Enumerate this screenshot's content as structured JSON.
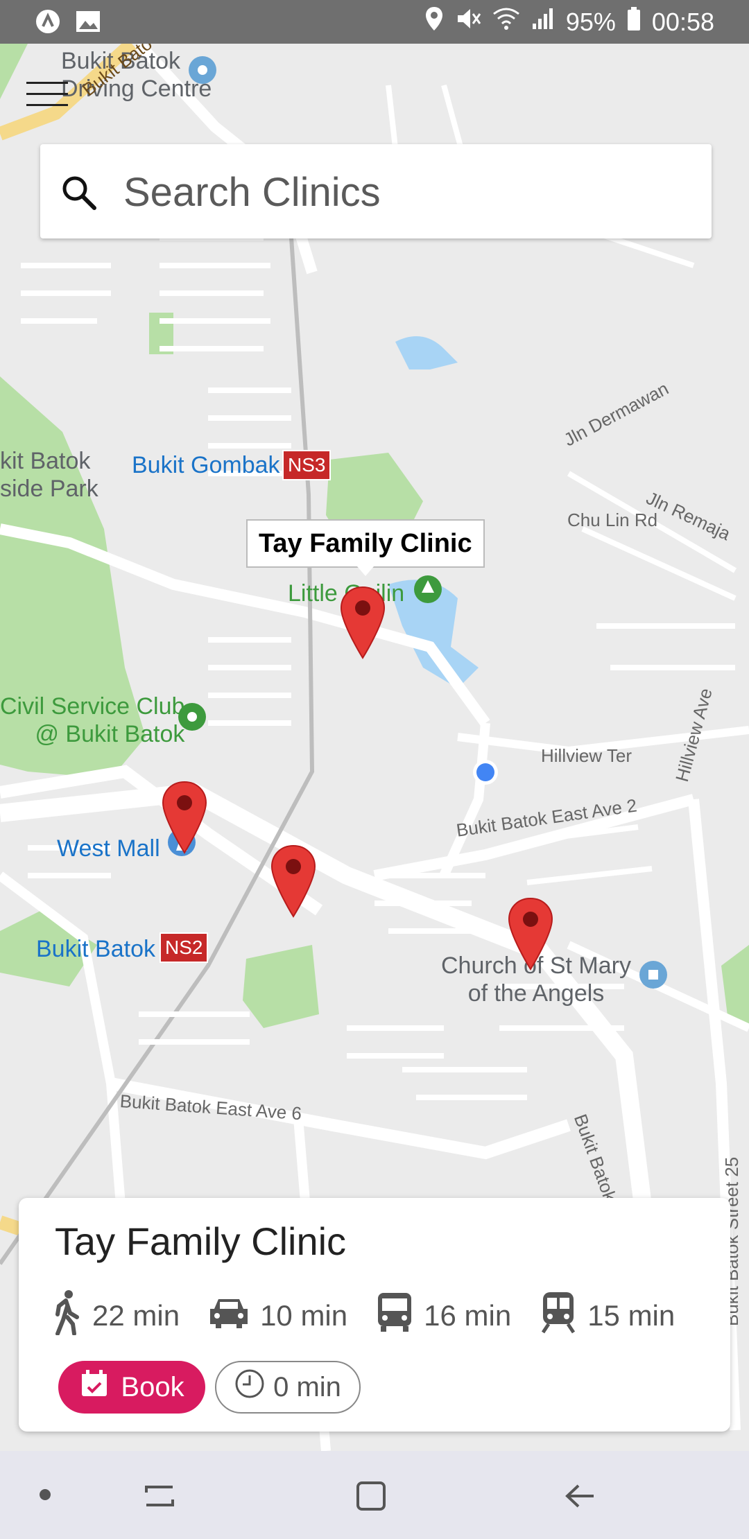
{
  "status_bar": {
    "battery": "95%",
    "time": "00:58"
  },
  "search": {
    "placeholder": "Search Clinics"
  },
  "tooltip": {
    "label": "Tay Family Clinic"
  },
  "map": {
    "labels": {
      "driving_centre": "Bukit Batok\nDriving Centre",
      "road_top": "Bukit Bato",
      "hillside_park": "kit Batok\nside Park",
      "bukit_gombak": "Bukit Gombak",
      "ns3": "NS3",
      "jln_dermawan": "Jln Dermawan",
      "jln_remaja": "Jln Remaja",
      "chu_lin_rd": "Chu Lin Rd",
      "little_guilin": "Little Guilin",
      "civil_service": "Civil Service Club\n@ Bukit Batok",
      "hillview_ter": "Hillview Ter",
      "hillview_ave": "Hillview Ave",
      "east_ave_2": "Bukit Batok East Ave 2",
      "west_mall": "West Mall",
      "bukit_batok": "Bukit Batok",
      "ns2": "NS2",
      "church": "Church of St Mary\nof the Angels",
      "east_ave_6": "Bukit Batok East Ave 6",
      "bukit_batok_road": "Bukit Batok",
      "street_25": "Bukit Batok Street 25"
    }
  },
  "card": {
    "title": "Tay Family Clinic",
    "walk": "22 min",
    "drive": "10 min",
    "bus": "16 min",
    "train": "15 min",
    "book_label": "Book",
    "wait_label": "0 min"
  }
}
